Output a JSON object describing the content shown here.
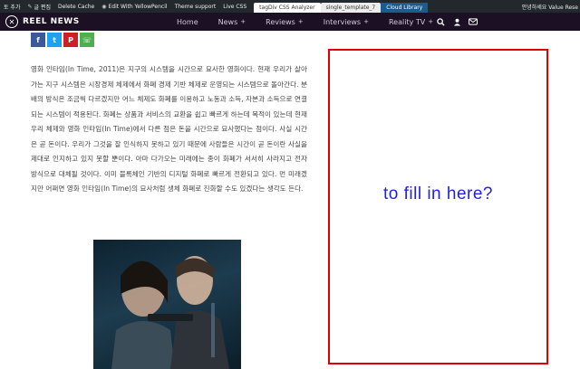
{
  "admin_bar": {
    "items": [
      {
        "icon": "",
        "label": "토 추가"
      },
      {
        "icon": "✎",
        "label": "글 편집"
      },
      {
        "icon": "",
        "label": "Delete Cache"
      },
      {
        "icon": "◉",
        "label": "Edit With YellowPencil"
      },
      {
        "icon": "",
        "label": "Theme support"
      },
      {
        "icon": "",
        "label": "Live CSS"
      }
    ],
    "tabs": [
      {
        "label": "tagDiv CSS Analyzer"
      },
      {
        "label": "single_template_7"
      }
    ],
    "cloud_library": "Cloud Library",
    "greeting": "안녕하세요 Value Rese"
  },
  "header": {
    "logo_text": "REEL NEWS",
    "nav": [
      {
        "label": "Home",
        "plus": ""
      },
      {
        "label": "News",
        "plus": "+"
      },
      {
        "label": "Reviews",
        "plus": "+"
      },
      {
        "label": "Interviews",
        "plus": "+"
      },
      {
        "label": "Reality TV",
        "plus": "+"
      }
    ]
  },
  "share": [
    {
      "name": "facebook",
      "glyph": "f",
      "color": "#3b5998"
    },
    {
      "name": "twitter",
      "glyph": "t",
      "color": "#1da1f2"
    },
    {
      "name": "pinterest",
      "glyph": "P",
      "color": "#cb2027"
    },
    {
      "name": "whatsapp",
      "glyph": "☏",
      "color": "#4caf50"
    }
  ],
  "article": {
    "body": "영화 인타임(In Time, 2011)은 지구의 시스템을 시간으로 묘사한 영화이다. 현재 우리가 살아가는 지구 시스템은 시장경제 체제에서 화폐 경제 기반 체제로 운영되는 시스템으로 돌아간다. 분배의 방식은 조금씩 다르겠지만 어느 체제도 화폐를 이용하고 노동과 소득, 자본과 소득으로 연결되는 시스템이 적용된다. 화폐는 상품과 서비스의 교환을 쉽고 빠르게 하는데 목적이 있는데 현재 우리 체제와 영화 인타임(In Time)에서 다른 점은 돈을 시간으로 묘사했다는 점이다. 사실 시간은 곧 돈이다. 우리가 그것을 잘 인식하지 못하고 있기 때문에 사람들은 시간이 곧 돈이란 사실을 제대로 인지하고 있지 못할 뿐이다. 아마 다가오는 미래에는 종이 화폐가 서서히 사라지고 전자 방식으로 대체될 것이다. 이미 블록체인 기반의 디지털 화폐로 빠르게 전환되고 있다. 먼 미래겠지만 어쩌면 영화 인타임(In Time)의 묘사처럼 생체 화폐로 진화할 수도 있겠다는 생각도 든다."
  },
  "annotation": {
    "label": "to fill in here?",
    "border_color": "#e00000",
    "text_color": "#2222e0"
  }
}
